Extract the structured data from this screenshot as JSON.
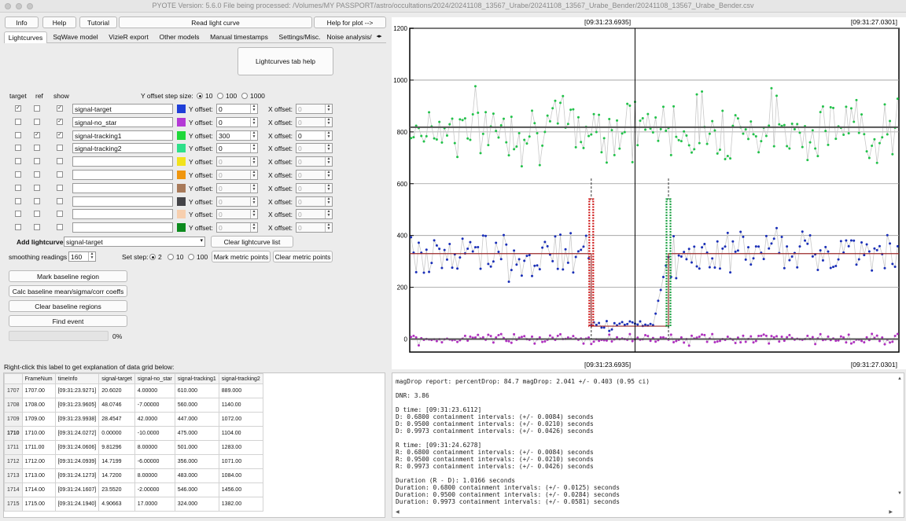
{
  "window": {
    "title": "PYOTE Version: 5.6.0   File being processed: /Volumes/MY PASSPORT/astro/occultations/2024/20241108_13567_Urabe/20241108_13567_Urabe_Bender/20241108_13567_Urabe_Bender.csv"
  },
  "toolbar": {
    "info": "Info",
    "help": "Help",
    "tutorial": "Tutorial",
    "read_light_curve": "Read light curve",
    "help_for_plot": "Help for plot -->"
  },
  "tabs": [
    "Lightcurves",
    "SqWave model",
    "VizieR export",
    "Other models",
    "Manual timestamps",
    "Settings/Misc.",
    "Noise analysis/"
  ],
  "lightcurves_tab_help": "Lightcurves tab help",
  "table_headers": {
    "target": "target",
    "ref": "ref",
    "show": "show"
  },
  "y_offset_step": {
    "label": "Y offset step size:",
    "options": [
      "10",
      "100",
      "1000"
    ],
    "selected": "10"
  },
  "curves": [
    {
      "name": "signal-target",
      "color": "#1f3fd8",
      "target": true,
      "ref": false,
      "show": true,
      "y_offset": "0",
      "x_offset": "0",
      "enabled": true,
      "x_enabled": false
    },
    {
      "name": "signal-no_star",
      "color": "#b43ad6",
      "target": false,
      "ref": false,
      "show": true,
      "y_offset": "0",
      "x_offset": "0",
      "enabled": true,
      "x_enabled": false
    },
    {
      "name": "signal-tracking1",
      "color": "#1fd83a",
      "target": false,
      "ref": true,
      "show": true,
      "y_offset": "300",
      "x_offset": "0",
      "enabled": true,
      "x_enabled": true
    },
    {
      "name": "signal-tracking2",
      "color": "#2ee08a",
      "target": false,
      "ref": false,
      "show": false,
      "y_offset": "0",
      "x_offset": "0",
      "enabled": true,
      "x_enabled": false
    },
    {
      "name": "",
      "color": "#f2e21b",
      "target": false,
      "ref": false,
      "show": false,
      "y_offset": "0",
      "x_offset": "0",
      "enabled": false,
      "x_enabled": false
    },
    {
      "name": "",
      "color": "#f0960e",
      "target": false,
      "ref": false,
      "show": false,
      "y_offset": "0",
      "x_offset": "0",
      "enabled": false,
      "x_enabled": false
    },
    {
      "name": "",
      "color": "#a87a5a",
      "target": false,
      "ref": false,
      "show": false,
      "y_offset": "0",
      "x_offset": "0",
      "enabled": false,
      "x_enabled": false
    },
    {
      "name": "",
      "color": "#444448",
      "target": false,
      "ref": false,
      "show": false,
      "y_offset": "0",
      "x_offset": "0",
      "enabled": false,
      "x_enabled": false
    },
    {
      "name": "",
      "color": "#f7cfae",
      "target": false,
      "ref": false,
      "show": false,
      "y_offset": "0",
      "x_offset": "0",
      "enabled": false,
      "x_enabled": false
    },
    {
      "name": "",
      "color": "#0c8a1e",
      "target": false,
      "ref": false,
      "show": false,
      "y_offset": "0",
      "x_offset": "0",
      "enabled": false,
      "x_enabled": false
    }
  ],
  "labels": {
    "y_offset": "Y offset:",
    "x_offset": "X offset:"
  },
  "add_lightcurve": {
    "label": "Add lightcurve",
    "value": "signal-target"
  },
  "clear_lightcurve_list": "Clear lightcurve list",
  "smoothing": {
    "label": "smoothing readings",
    "value": "160"
  },
  "set_step": {
    "label": "Set step:",
    "options": [
      "2",
      "10",
      "100"
    ],
    "selected": "2"
  },
  "mark_metric_points": "Mark metric points",
  "clear_metric_points": "Clear metric points",
  "mark_baseline_region": "Mark baseline region",
  "calc_baseline": "Calc baseline mean/sigma/corr coeffs",
  "clear_baseline_regions": "Clear baseline regions",
  "find_event": "Find event",
  "progress": {
    "value": 0,
    "text": "0%"
  },
  "grid_caption": "Right-click this label to get explanation of data grid below:",
  "grid": {
    "columns": [
      "FrameNum",
      "timeInfo",
      "signal-target",
      "signal-no_star",
      "signal-tracking1",
      "signal-tracking2"
    ],
    "rows": [
      {
        "id": "1707",
        "cells": [
          "1707.00",
          "[09:31:23.9271]",
          "20.6020",
          "4.00000",
          "610.000",
          "889.000"
        ]
      },
      {
        "id": "1708",
        "cells": [
          "1708.00",
          "[09:31:23.9605]",
          "48.0746",
          "-7.00000",
          "560.000",
          "1140.00"
        ]
      },
      {
        "id": "1709",
        "cells": [
          "1709.00",
          "[09:31:23.9938]",
          "28.4547",
          "42.0000",
          "447.000",
          "1072.00"
        ]
      },
      {
        "id": "1710",
        "cells": [
          "1710.00",
          "[09:31:24.0272]",
          "0.00000",
          "-10.0000",
          "475.000",
          "1104.00"
        ]
      },
      {
        "id": "1711",
        "cells": [
          "1711.00",
          "[09:31:24.0606]",
          "9.81296",
          "8.00000",
          "501.000",
          "1283.00"
        ]
      },
      {
        "id": "1712",
        "cells": [
          "1712.00",
          "[09:31:24.0939]",
          "14.7199",
          "-6.00000",
          "356.000",
          "1071.00"
        ]
      },
      {
        "id": "1713",
        "cells": [
          "1713.00",
          "[09:31:24.1273]",
          "14.7200",
          "8.00000",
          "483.000",
          "1084.00"
        ]
      },
      {
        "id": "1714",
        "cells": [
          "1714.00",
          "[09:31:24.1607]",
          "23.5520",
          "-2.00000",
          "546.000",
          "1456.00"
        ]
      },
      {
        "id": "1715",
        "cells": [
          "1715.00",
          "[09:31:24.1940]",
          "4.90663",
          "17.0000",
          "324.000",
          "1382.00"
        ]
      }
    ]
  },
  "report_text": "magDrop report: percentDrop: 84.7 magDrop: 2.041 +/- 0.403 (0.95 ci)\n\nDNR: 3.86\n\nD time: [09:31:23.6112]\nD: 0.6800 containment intervals: (+/- 0.0084) seconds\nD: 0.9500 containment intervals: (+/- 0.0210) seconds\nD: 0.9973 containment intervals: (+/- 0.0426) seconds\n\nR time: [09:31:24.6278]\nR: 0.6800 containment intervals: (+/- 0.0084) seconds\nR: 0.9500 containment intervals: (+/- 0.0210) seconds\nR: 0.9973 containment intervals: (+/- 0.0426) seconds\n\nDuration (R - D): 1.0166 seconds\nDuration: 0.6800 containment intervals: (+/- 0.0125) seconds\nDuration: 0.9500 containment intervals: (+/- 0.0284) seconds\nDuration: 0.9973 containment intervals: (+/- 0.0581) seconds",
  "chart_data": {
    "type": "scatter",
    "title": "",
    "xlabel": "",
    "ylabel": "",
    "ylim": [
      -50,
      1200
    ],
    "y_ticks": [
      0,
      200,
      400,
      600,
      800,
      1000,
      1200
    ],
    "top_left_time": "[09:31:23.6935]",
    "top_right_time": "[09:31:27.0301]",
    "bottom_left_time": "[09:31:23.6935]",
    "bottom_right_time": "[09:31:27.0301]",
    "grid": true,
    "series": [
      {
        "color": "#22c24a",
        "baseline": 818,
        "sigma": 90,
        "seed": 7
      },
      {
        "color": "#1a2fb8",
        "baseline": 330,
        "sigma": 65,
        "seed": 13,
        "drop_level": 50,
        "d_index": 70,
        "r_index": 100
      },
      {
        "color": "#b030c0",
        "baseline": 0,
        "sigma": 14,
        "seed": 29
      }
    ],
    "n_points": 190,
    "d_index": 70,
    "r_index": 100,
    "cursor_index": 87
  }
}
